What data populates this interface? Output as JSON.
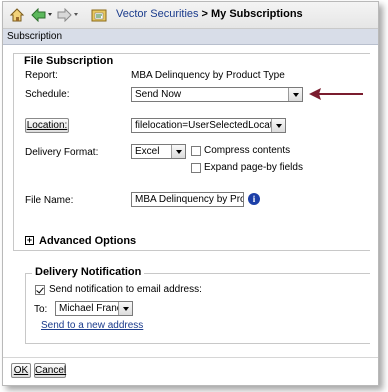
{
  "breadcrumb": {
    "link": "Vector Securities",
    "separator": ">",
    "current": "My Subscriptions"
  },
  "section_header": "Subscription",
  "file_subscription": {
    "legend": "File Subscription",
    "report_label": "Report:",
    "report_value": "MBA Delinquency by Product Type",
    "schedule_label": "Schedule:",
    "schedule_value": "Send Now",
    "location_button": "Location:",
    "location_value": "filelocation=UserSelectedLocation",
    "delivery_format_label": "Delivery Format:",
    "delivery_format_value": "Excel",
    "compress_label": "Compress contents",
    "compress_checked": false,
    "expand_label": "Expand page-by fields",
    "expand_checked": false,
    "file_name_label": "File Name:",
    "file_name_value": "MBA Delinquency by Product T"
  },
  "advanced_options": {
    "toggle": "+",
    "label": "Advanced Options"
  },
  "delivery_notification": {
    "legend": "Delivery Notification",
    "send_label": "Send notification to email address:",
    "send_checked": true,
    "to_label": "To:",
    "to_value": "Michael Francis",
    "new_address_link": "Send to a new address"
  },
  "footer": {
    "ok": "OK",
    "cancel": "Cancel"
  },
  "colors": {
    "link": "#1a3b8c",
    "annotation_arrow": "#7a1c2e",
    "info_icon": "#1c3fa8"
  },
  "icons": [
    "home-icon",
    "back-arrow-icon",
    "forward-arrow-icon",
    "folder-icon",
    "info-icon"
  ]
}
